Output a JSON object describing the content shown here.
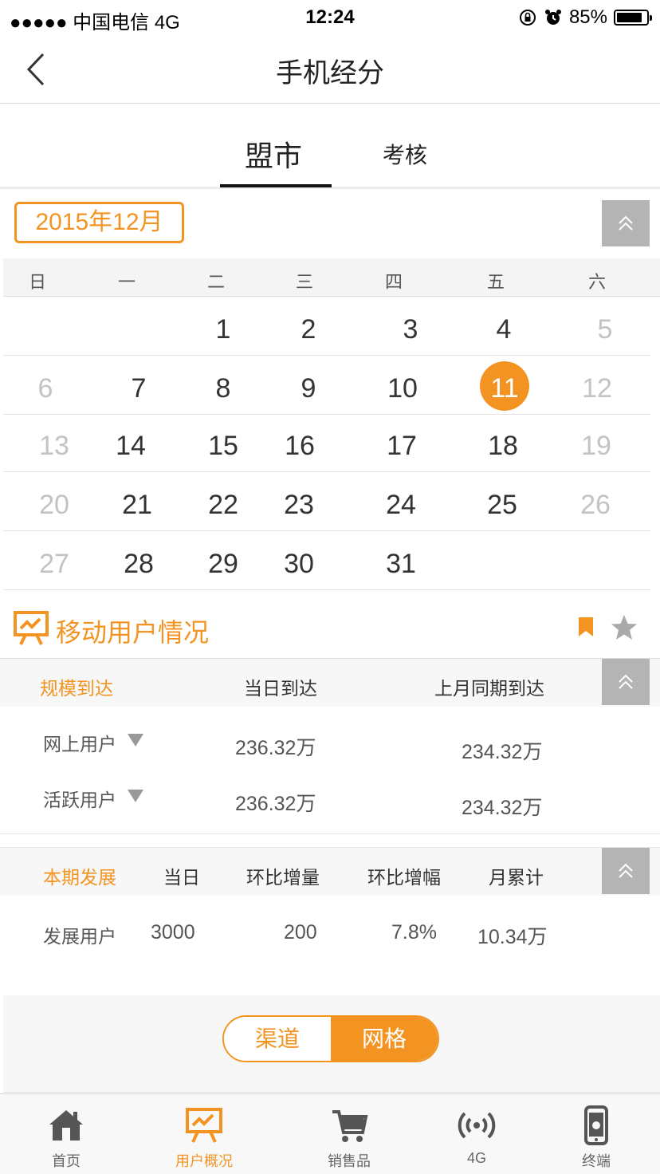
{
  "status_bar": {
    "carrier": "●●●●● 中国电信  4G",
    "time": "12:24",
    "battery": "85%"
  },
  "nav": {
    "title": "手机经分"
  },
  "tabs": [
    {
      "label": "盟市",
      "active": true
    },
    {
      "label": "考核",
      "active": false
    }
  ],
  "calendar": {
    "month_label": "2015年12月",
    "weekdays": [
      "日",
      "一",
      "二",
      "三",
      "四",
      "五",
      "六"
    ],
    "rows": [
      [
        "",
        "",
        "1",
        "2",
        "3",
        "4",
        "5"
      ],
      [
        "6",
        "7",
        "8",
        "9",
        "10",
        "11",
        "12"
      ],
      [
        "13",
        "14",
        "15",
        "16",
        "17",
        "18",
        "19"
      ],
      [
        "20",
        "21",
        "22",
        "23",
        "24",
        "25",
        "26"
      ],
      [
        "27",
        "28",
        "29",
        "30",
        "31",
        "",
        ""
      ]
    ],
    "selected_day": "11"
  },
  "section": {
    "title": "移动用户情况"
  },
  "scale_panel": {
    "headers": [
      "规模到达",
      "当日到达",
      "上月同期到达"
    ],
    "rows": [
      {
        "label": "网上用户",
        "today": "236.32万",
        "last_month": "234.32万"
      },
      {
        "label": "活跃用户",
        "today": "236.32万",
        "last_month": "234.32万"
      }
    ]
  },
  "dev_panel": {
    "headers": [
      "本期发展",
      "当日",
      "环比增量",
      "环比增幅",
      "月累计"
    ],
    "rows": [
      {
        "label": "发展用户",
        "today": "3000",
        "delta": "200",
        "rate": "7.8%",
        "month_total": "10.34万"
      }
    ]
  },
  "segment": {
    "left": "渠道",
    "right": "网格",
    "active": "网格"
  },
  "tabbar": [
    {
      "label": "首页",
      "icon": "home-icon",
      "active": false
    },
    {
      "label": "用户概况",
      "icon": "presentation-chart-icon",
      "active": true
    },
    {
      "label": "销售品",
      "icon": "cart-icon",
      "active": false
    },
    {
      "label": "4G",
      "icon": "signal-broadcast-icon",
      "active": false
    },
    {
      "label": "终端",
      "icon": "phone-device-icon",
      "active": false
    }
  ],
  "colors": {
    "accent": "#f39422",
    "collapse_button": "#b4b4b4"
  }
}
